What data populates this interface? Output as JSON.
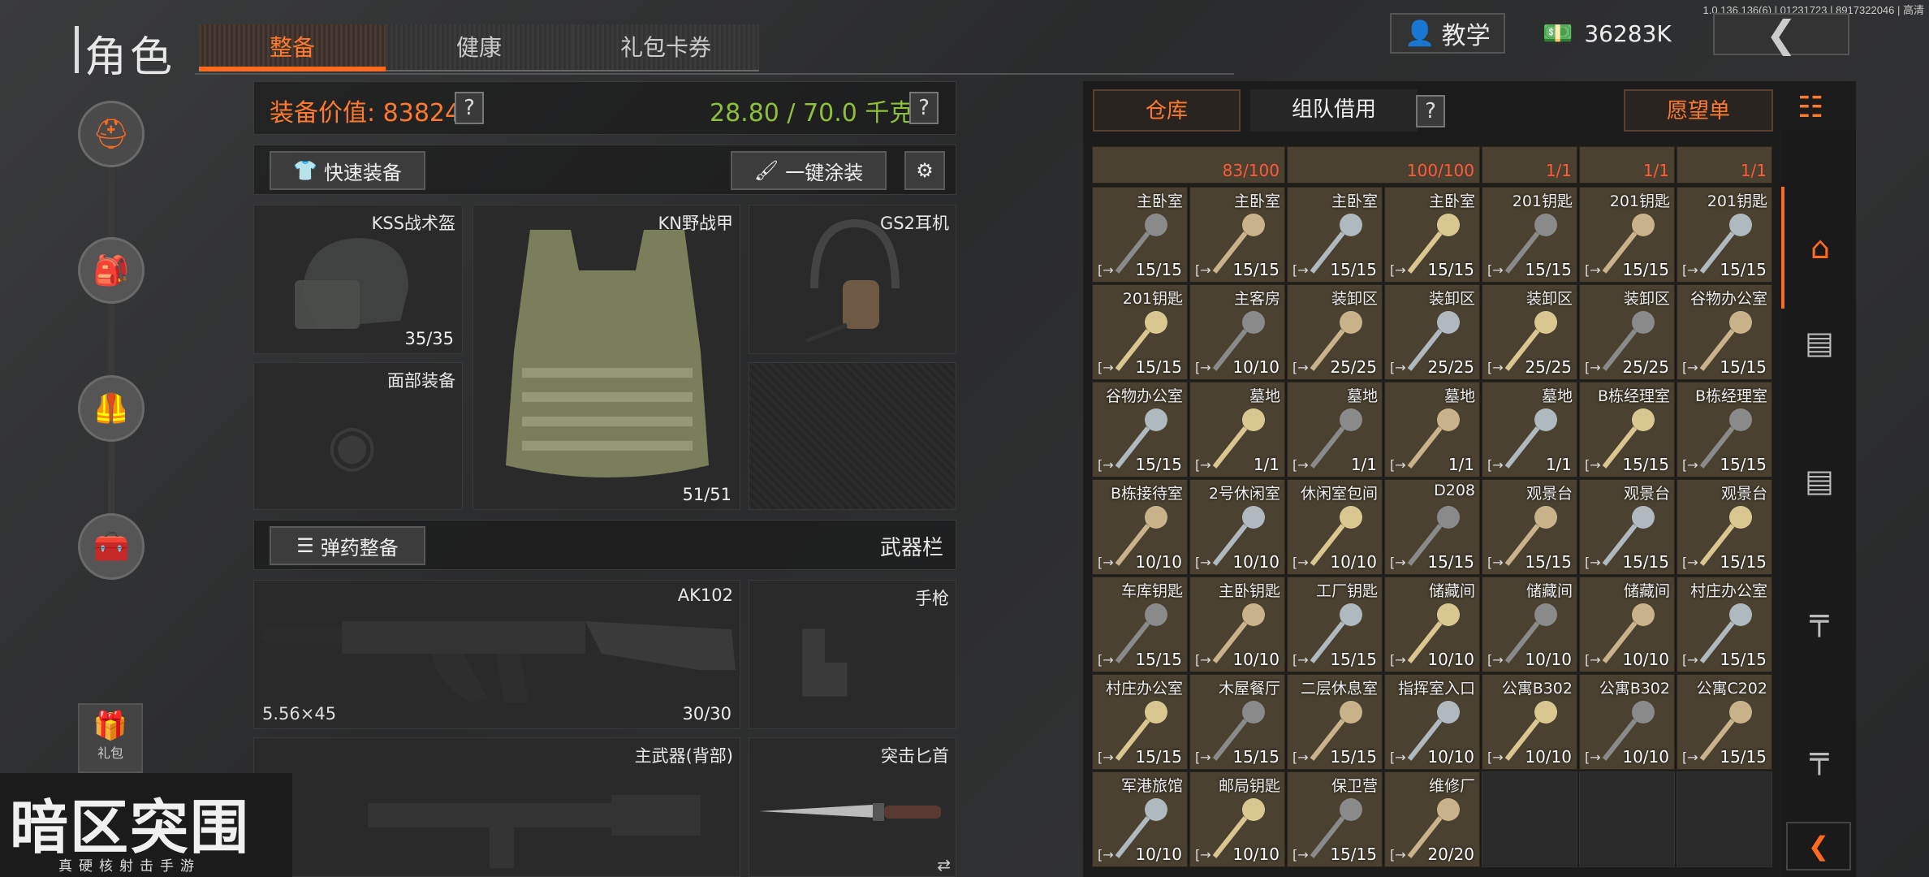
{
  "version": "1.0.136.136(6) | 01231723 | 8917322046 | 高清",
  "title": "角色",
  "tabs": [
    {
      "label": "整备",
      "active": true
    },
    {
      "label": "健康",
      "active": false
    },
    {
      "label": "礼包卡券",
      "active": false
    }
  ],
  "top": {
    "tutorial": "教学",
    "money": "36283K"
  },
  "side": {
    "gift": "礼包"
  },
  "equip": {
    "value_label": "装备价值: 83824",
    "weight": "28.80 / 70.0 千克",
    "help": "?",
    "quick_equip": "快速装备",
    "paint": "一键涂装",
    "helmet": {
      "name": "KSS战术盔",
      "count": "35/35"
    },
    "vest": {
      "name": "KN野战甲",
      "count": "51/51"
    },
    "headset": {
      "name": "GS2耳机"
    },
    "face": {
      "name": "面部装备"
    },
    "ammo_btn": "弹药整备",
    "weapon_bar": "武器栏",
    "primary": {
      "name": "AK102",
      "caliber": "5.56×45",
      "count": "30/30"
    },
    "pistol": {
      "name": "手枪"
    },
    "back_weapon": {
      "name": "主武器(背部)"
    },
    "knife": {
      "name": "突击匕首"
    }
  },
  "logo": {
    "big": "暗区突围",
    "small": "真硬核射击手游"
  },
  "storage": {
    "tab_warehouse": "仓库",
    "tab_team": "组队借用",
    "help": "?",
    "wishlist": "愿望单",
    "top_counts": [
      "83/100",
      "100/100",
      "1/1",
      "1/1",
      "1/1"
    ],
    "items": [
      {
        "n": "主卧室",
        "c": "15/15"
      },
      {
        "n": "主卧室",
        "c": "15/15"
      },
      {
        "n": "主卧室",
        "c": "15/15"
      },
      {
        "n": "主卧室",
        "c": "15/15"
      },
      {
        "n": "201钥匙",
        "c": "15/15"
      },
      {
        "n": "201钥匙",
        "c": "15/15"
      },
      {
        "n": "201钥匙",
        "c": "15/15"
      },
      {
        "n": "201钥匙",
        "c": "15/15"
      },
      {
        "n": "主客房",
        "c": "10/10"
      },
      {
        "n": "装卸区",
        "c": "25/25"
      },
      {
        "n": "装卸区",
        "c": "25/25"
      },
      {
        "n": "装卸区",
        "c": "25/25"
      },
      {
        "n": "装卸区",
        "c": "25/25"
      },
      {
        "n": "谷物办公室",
        "c": "15/15"
      },
      {
        "n": "谷物办公室",
        "c": "15/15"
      },
      {
        "n": "墓地",
        "c": "1/1"
      },
      {
        "n": "墓地",
        "c": "1/1"
      },
      {
        "n": "墓地",
        "c": "1/1"
      },
      {
        "n": "墓地",
        "c": "1/1"
      },
      {
        "n": "B栋经理室",
        "c": "15/15"
      },
      {
        "n": "B栋经理室",
        "c": "15/15"
      },
      {
        "n": "B栋接待室",
        "c": "10/10"
      },
      {
        "n": "2号休闲室",
        "c": "10/10"
      },
      {
        "n": "休闲室包间",
        "c": "10/10"
      },
      {
        "n": "D208",
        "c": "15/15"
      },
      {
        "n": "观景台",
        "c": "15/15"
      },
      {
        "n": "观景台",
        "c": "15/15"
      },
      {
        "n": "观景台",
        "c": "15/15"
      },
      {
        "n": "车库钥匙",
        "c": "15/15"
      },
      {
        "n": "主卧钥匙",
        "c": "10/10"
      },
      {
        "n": "工厂钥匙",
        "c": "15/15"
      },
      {
        "n": "储藏间",
        "c": "10/10"
      },
      {
        "n": "储藏间",
        "c": "10/10"
      },
      {
        "n": "储藏间",
        "c": "10/10"
      },
      {
        "n": "村庄办公室",
        "c": "15/15"
      },
      {
        "n": "村庄办公室",
        "c": "15/15"
      },
      {
        "n": "木屋餐厅",
        "c": "15/15"
      },
      {
        "n": "二层休息室",
        "c": "15/15"
      },
      {
        "n": "指挥室入口",
        "c": "10/10"
      },
      {
        "n": "公寓B302",
        "c": "10/10"
      },
      {
        "n": "公寓B302",
        "c": "10/10"
      },
      {
        "n": "公寓C202",
        "c": "15/15"
      },
      {
        "n": "军港旅馆",
        "c": "10/10"
      },
      {
        "n": "邮局钥匙",
        "c": "10/10"
      },
      {
        "n": "保卫营",
        "c": "15/15"
      },
      {
        "n": "维修厂",
        "c": "20/20"
      }
    ]
  },
  "colors": {
    "accent": "#ff6a1f",
    "weight": "#8fc03a",
    "cell": "#4a4130"
  }
}
